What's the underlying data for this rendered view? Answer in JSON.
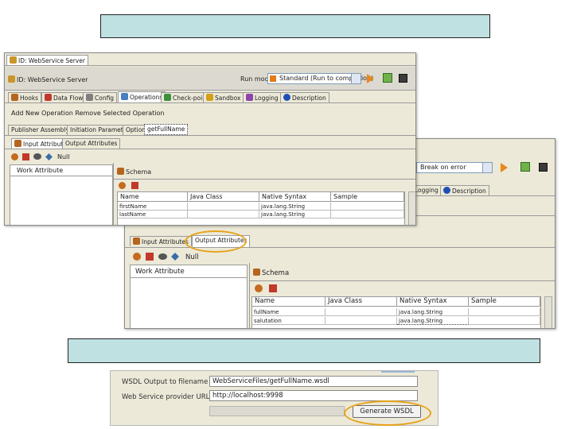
{
  "win1": {
    "tab_title": "ID: WebService Server",
    "header_title": "ID: WebService Server",
    "run_mode_label": "Run mode",
    "run_mode_value": "Standard (Run to completion)",
    "tabs": [
      "Hooks",
      "Data Flow",
      "Config",
      "Operations",
      "Check-point",
      "Sandbox",
      "Logging",
      "Description"
    ],
    "ops_text": "Add New Operation  Remove Selected Operation",
    "subtabs": [
      "Publisher Assembly",
      "Initiation Parameters",
      "Options",
      "getFullName"
    ],
    "io_tabs": [
      "Input Attributes",
      "Output Attributes"
    ],
    "null_label": "Null",
    "work_attribute": "Work Attribute",
    "schema_label": "Schema",
    "columns": [
      "Name",
      "Java Class",
      "Native Syntax",
      "Sample"
    ],
    "rows": [
      {
        "name": "firstName",
        "java": "",
        "native": "java.lang.String",
        "sample": ""
      },
      {
        "name": "lastName",
        "java": "",
        "native": "java.lang.String",
        "sample": ""
      }
    ]
  },
  "win2": {
    "combo_value": "Break on error",
    "tabs": [
      "Logging",
      "Description"
    ],
    "io_tabs": [
      "Input Attributes",
      "Output Attributes"
    ],
    "null_label": "Null",
    "work_attribute": "Work Attribute",
    "schema_label": "Schema",
    "columns": [
      "Name",
      "Java Class",
      "Native Syntax",
      "Sample"
    ],
    "rows": [
      {
        "name": "fullName",
        "java": "",
        "native": "java.lang.String",
        "sample": ""
      },
      {
        "name": "salutation",
        "java": "",
        "native": "java.lang.String",
        "sample": ""
      }
    ]
  },
  "wsdl": {
    "output_label": "WSDL Output to filename",
    "output_value": "WebServiceFiles/getFullName.wsdl",
    "provider_label": "Web Service provider URL",
    "provider_value": "http://localhost:9998",
    "generate_button": "Generate WSDL"
  },
  "colors": {
    "highlight_oval": "#e7a21a",
    "banner": "#bfe1e1"
  }
}
